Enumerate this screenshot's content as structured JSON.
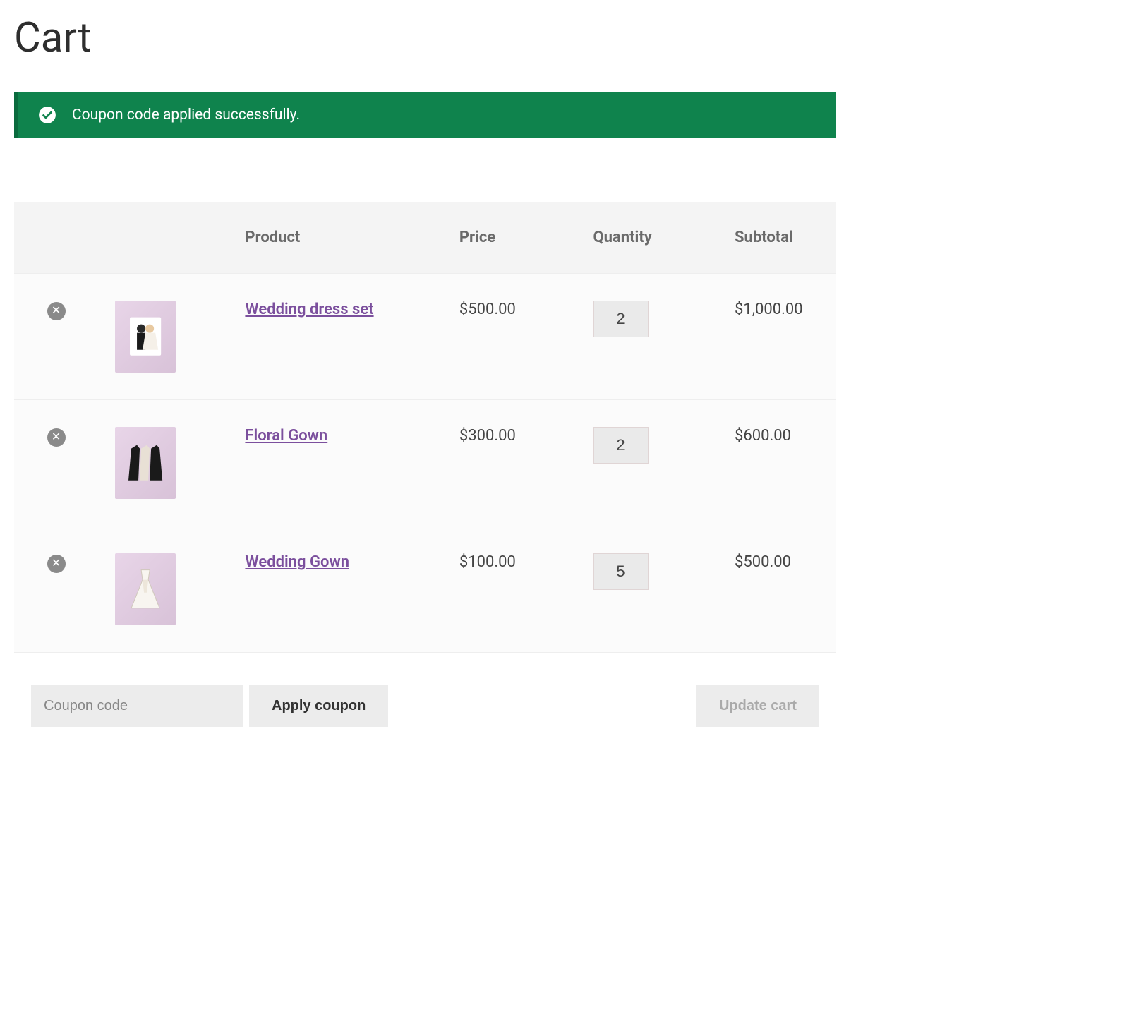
{
  "page": {
    "title": "Cart"
  },
  "notice": {
    "message": "Coupon code applied successfully."
  },
  "table": {
    "headers": {
      "product": "Product",
      "price": "Price",
      "quantity": "Quantity",
      "subtotal": "Subtotal"
    }
  },
  "items": [
    {
      "name": "Wedding dress set",
      "price": "$500.00",
      "quantity": "2",
      "subtotal": "$1,000.00"
    },
    {
      "name": "Floral Gown",
      "price": "$300.00",
      "quantity": "2",
      "subtotal": "$600.00"
    },
    {
      "name": "Wedding Gown",
      "price": "$100.00",
      "quantity": "5",
      "subtotal": "$500.00"
    }
  ],
  "coupon": {
    "placeholder": "Coupon code",
    "apply_label": "Apply coupon"
  },
  "update_label": "Update cart"
}
